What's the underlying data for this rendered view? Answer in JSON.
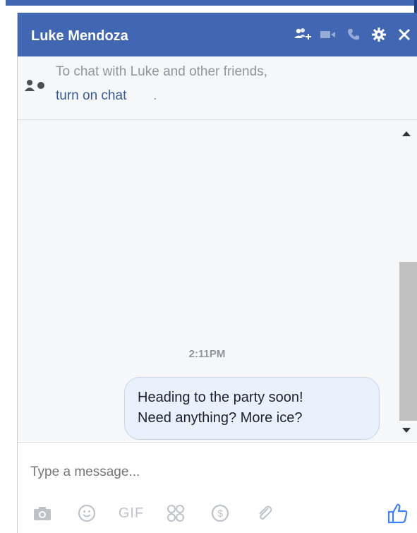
{
  "chat_window": {
    "title": "Luke Mendoza",
    "header_icons": [
      "add-people-icon",
      "video-call-icon",
      "phone-icon",
      "gear-icon",
      "close-icon"
    ]
  },
  "notice": {
    "text": "To chat with Luke and other friends,",
    "link": "turn on chat",
    "suffix": "."
  },
  "conversation": {
    "timestamp": "2:11PM",
    "messages": [
      {
        "line1": "Heading to the party soon!",
        "line2": "Need anything? More ice?"
      }
    ]
  },
  "composer": {
    "placeholder": "Type a message...",
    "gif_label": "GIF",
    "toolbar_icons": [
      "camera-icon",
      "emoji-icon",
      "gif-icon",
      "stickers-icon",
      "payment-icon",
      "attachment-icon"
    ],
    "send_icon": "thumbs-up-icon"
  },
  "colors": {
    "header": "#4267b2",
    "link": "#365899",
    "bubble": "#e9f1fd",
    "icon_gray": "#bec3c9",
    "like_blue": "#4080ff"
  }
}
